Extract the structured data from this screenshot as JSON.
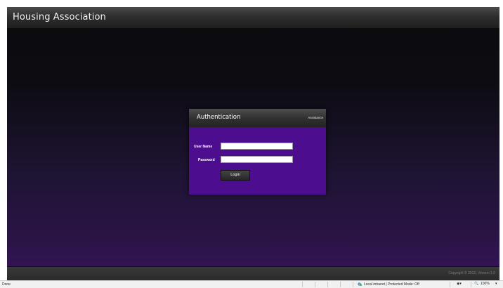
{
  "app": {
    "title": "Housing Association",
    "footer_copyright": "Copyright © 2012,  Version 1.0"
  },
  "auth": {
    "title": "Authentication",
    "assistance_label": "Assistance",
    "username_label": "User Name",
    "username_value": "",
    "password_label": "Password",
    "password_value": "",
    "login_label": "Login"
  },
  "statusbar": {
    "status_text": "Done",
    "zone_text": "Local intranet | Protected Mode: Off",
    "zoom_level": "100%"
  },
  "colors": {
    "panel_background": "#4c0d8e",
    "page_gradient_top": "#0c0c0e",
    "page_gradient_bottom": "#321452",
    "header_bar": "#2e2e2e"
  },
  "icons": {
    "zone": "globe-icon",
    "protected_mode": "settings-dropdown-icon",
    "zoom": "zoom-icon"
  }
}
